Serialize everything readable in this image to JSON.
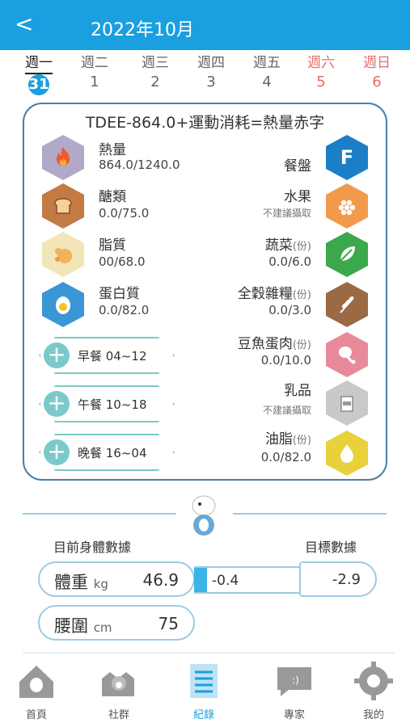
{
  "header": {
    "back_icon": "chevron-left-icon",
    "back_glyph": "<",
    "title": "2022年10月"
  },
  "week": {
    "days": [
      {
        "name": "週一",
        "num": "31"
      },
      {
        "name": "週二",
        "num": "1"
      },
      {
        "name": "週三",
        "num": "2"
      },
      {
        "name": "週四",
        "num": "3"
      },
      {
        "name": "週五",
        "num": "4"
      },
      {
        "name": "週六",
        "num": "5"
      },
      {
        "name": "週日",
        "num": "6"
      }
    ]
  },
  "summary": {
    "title": "TDEE-864.0+運動消耗=熱量赤字",
    "left": [
      {
        "label": "熱量",
        "value": "864.0/1240.0",
        "icon": "flame-icon",
        "color": "#b0a9c8"
      },
      {
        "label": "醣類",
        "value": "0.0/75.0",
        "icon": "bread-icon",
        "color": "#c47a45"
      },
      {
        "label": "脂質",
        "value": "00/68.0",
        "icon": "chicken-icon",
        "color": "#f2e6b8"
      },
      {
        "label": "蛋白質",
        "value": "0.0/82.0",
        "icon": "egg-icon",
        "color": "#3a96d4"
      }
    ],
    "right": [
      {
        "label": "餐盤",
        "unit": "",
        "value": "",
        "note": "",
        "icon": "plate-f-icon",
        "color": "#1a7fc4",
        "glyph": "F"
      },
      {
        "label": "水果",
        "unit": "",
        "value": "",
        "note": "不建議攝取",
        "icon": "grapes-icon",
        "color": "#f29a4b"
      },
      {
        "label": "蔬菜",
        "unit": "(份)",
        "value": "0.0/6.0",
        "note": "",
        "icon": "leaf-icon",
        "color": "#3aa84b"
      },
      {
        "label": "全穀雜糧",
        "unit": "(份)",
        "value": "0.0/3.0",
        "note": "",
        "icon": "wheat-icon",
        "color": "#9a6a45"
      },
      {
        "label": "豆魚蛋肉",
        "unit": "(份)",
        "value": "0.0/10.0",
        "note": "",
        "icon": "drumstick-icon",
        "color": "#e88a9a"
      },
      {
        "label": "乳品",
        "unit": "",
        "value": "",
        "note": "不建議攝取",
        "icon": "milk-icon",
        "color": "#c9c9c9"
      },
      {
        "label": "油脂",
        "unit": "(份)",
        "value": "0.0/82.0",
        "note": "",
        "icon": "oil-drop-icon",
        "color": "#e8d13a"
      }
    ],
    "meals": [
      {
        "label": "早餐  04~12"
      },
      {
        "label": "午餐  10~18"
      },
      {
        "label": "晚餐  16~04"
      }
    ]
  },
  "body_data": {
    "current_label": "目前身體數據",
    "target_label": "目標數據",
    "weight": {
      "label": "體重",
      "unit": "kg",
      "value": "46.9"
    },
    "diff": "-0.4",
    "target": "-2.9",
    "waist": {
      "label": "腰圍",
      "unit": "cm",
      "value": "75"
    }
  },
  "tabs": [
    {
      "label": "首頁",
      "icon": "home-icon"
    },
    {
      "label": "社群",
      "icon": "community-icon"
    },
    {
      "label": "紀錄",
      "icon": "record-icon"
    },
    {
      "label": "專家",
      "icon": "chat-icon"
    },
    {
      "label": "我的",
      "icon": "gear-icon"
    }
  ],
  "colors": {
    "accent": "#1a9fe0",
    "weekend": "#e86b6b",
    "card_border": "#4a7fa7",
    "teal": "#7cc9c9"
  }
}
